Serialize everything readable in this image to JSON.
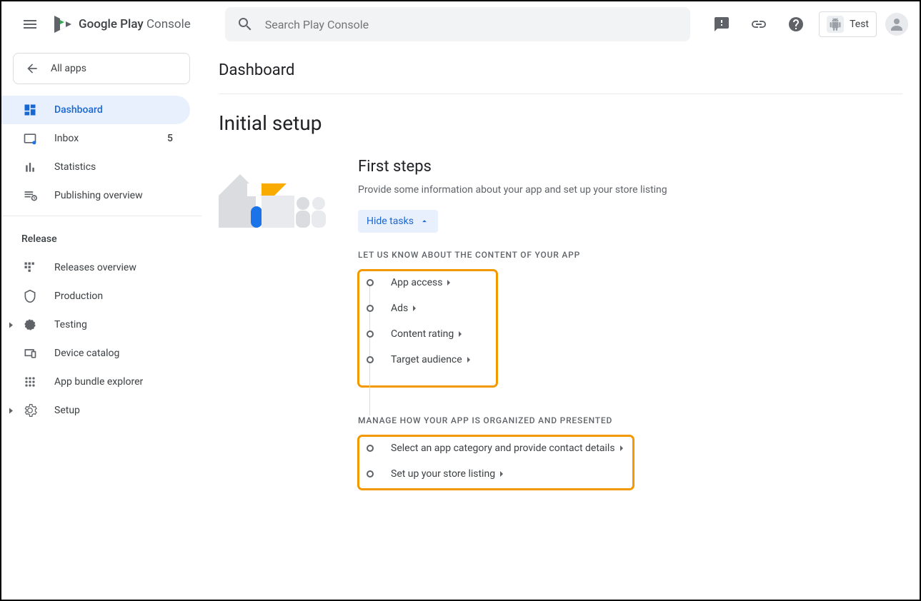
{
  "header": {
    "logo_text_1": "Google Play",
    "logo_text_2": "Console",
    "search_placeholder": "Search Play Console",
    "app_label": "Test"
  },
  "sidebar": {
    "all_apps": "All apps",
    "items": [
      {
        "label": "Dashboard",
        "active": true
      },
      {
        "label": "Inbox",
        "badge": "5"
      },
      {
        "label": "Statistics"
      },
      {
        "label": "Publishing overview"
      }
    ],
    "release_header": "Release",
    "release_items": [
      {
        "label": "Releases overview"
      },
      {
        "label": "Production"
      },
      {
        "label": "Testing"
      },
      {
        "label": "Device catalog"
      },
      {
        "label": "App bundle explorer"
      },
      {
        "label": "Setup"
      }
    ]
  },
  "main": {
    "page_title": "Dashboard",
    "section_title": "Initial setup",
    "card": {
      "title": "First steps",
      "desc": "Provide some information about your app and set up your store listing",
      "hide_tasks": "Hide tasks"
    },
    "group1_header": "LET US KNOW ABOUT THE CONTENT OF YOUR APP",
    "group1_tasks": [
      {
        "label": "App access"
      },
      {
        "label": "Ads"
      },
      {
        "label": "Content rating"
      },
      {
        "label": "Target audience"
      }
    ],
    "group2_header": "MANAGE HOW YOUR APP IS ORGANIZED AND PRESENTED",
    "group2_tasks": [
      {
        "label": "Select an app category and provide contact details"
      },
      {
        "label": "Set up your store listing"
      }
    ]
  }
}
